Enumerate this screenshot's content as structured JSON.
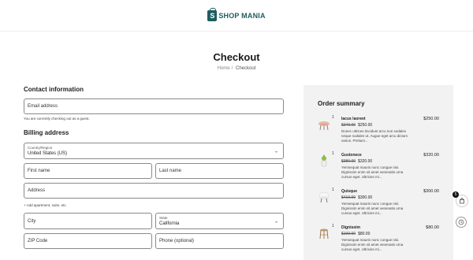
{
  "brand": {
    "logo_letter": "S",
    "name": "SHOP MANIA",
    "color": "#1f5d5f"
  },
  "page": {
    "title": "Checkout"
  },
  "breadcrumb": {
    "home": "Home",
    "separator": "/",
    "current": "Checkout"
  },
  "contact": {
    "heading": "Contact information",
    "email_placeholder": "Email address",
    "guest_note": "You are currently checking out as a guest."
  },
  "billing": {
    "heading": "Billing address",
    "country_label": "Country/Region",
    "country_value": "United States (US)",
    "first_name_placeholder": "First name",
    "last_name_placeholder": "Last name",
    "address_placeholder": "Address",
    "add_line": "+ Add apartment, suite, etc.",
    "city_placeholder": "City",
    "state_label": "State",
    "state_value": "California",
    "zip_placeholder": "ZIP Code",
    "phone_placeholder": "Phone (optional)"
  },
  "summary": {
    "heading": "Order summary",
    "items": [
      {
        "qty": "1",
        "name": "Iacus laoreet",
        "old_price": "$340.00",
        "new_price": "$250.00",
        "description": "Donec ultrices tincidunt arcu non sodales neque sodales ut. Augue eget arcu dictum varius. Pretium...",
        "total": "$250.00",
        "icon": "pink-chair-icon"
      },
      {
        "qty": "1",
        "name": "Gustonece",
        "old_price": "$380.00",
        "new_price": "$320.00",
        "description": "Yemsequat mauris nunc congue nisi. Dignissim enim sit amet venenatis urna cursus eget. Ultricies mi...",
        "total": "$320.00",
        "icon": "plant-pot-icon"
      },
      {
        "qty": "1",
        "name": "Quisque",
        "old_price": "$410.00",
        "new_price": "$300.00",
        "description": "Yemsequat mauris nunc congue nisi. Dignissim enim sit amet venenatis urna cursus eget. Ultricies mi...",
        "total": "$300.00",
        "icon": "white-chair-icon"
      },
      {
        "qty": "1",
        "name": "Dignissim",
        "old_price": "$100.00",
        "new_price": "$80.00",
        "description": "Yemsequat mauris nunc congue nisi. Dignissim enim sit amet venenatis urna cursus eget. Ultricies mi...",
        "total": "$80.00",
        "icon": "wooden-stool-icon"
      }
    ]
  },
  "floating": {
    "cart_count": "5"
  }
}
